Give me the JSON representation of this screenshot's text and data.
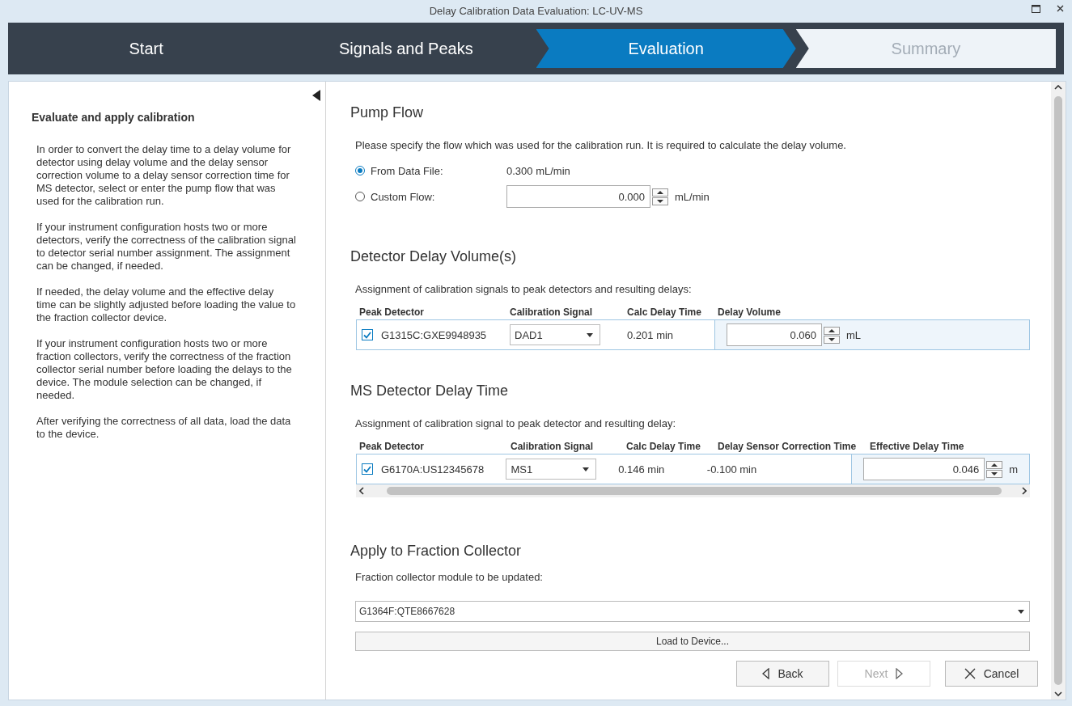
{
  "window": {
    "title": "Delay Calibration Data Evaluation: LC-UV-MS"
  },
  "steps": [
    {
      "label": "Start",
      "selected": false,
      "disabled": false
    },
    {
      "label": "Signals and Peaks",
      "selected": false,
      "disabled": false
    },
    {
      "label": "Evaluation",
      "selected": true,
      "disabled": false
    },
    {
      "label": "Summary",
      "selected": false,
      "disabled": true
    }
  ],
  "help": {
    "title": "Evaluate and apply calibration",
    "paragraphs": [
      "In order to convert the delay time to a delay volume for detector using delay volume and the delay sensor correction volume to a delay sensor correction time for MS detector, select or enter the pump flow that was used for the calibration run.",
      "If your instrument configuration hosts two or more detectors, verify the correctness of the calibration signal to detector serial number assignment. The assignment can be changed, if needed.",
      "If needed, the delay volume and the effective delay time can be slightly adjusted before loading the value to the fraction collector device.",
      "If your instrument configuration hosts two or more fraction collectors, verify the correctness of the fraction collector serial number before loading the delays to the device. The module selection can be changed, if needed.",
      "After verifying the correctness of all data, load the data to the device."
    ]
  },
  "pump_flow": {
    "title": "Pump Flow",
    "description": "Please specify the flow which was used for the calibration run. It is required to calculate the delay volume.",
    "options": [
      {
        "kind": "text",
        "label": "From Data File:",
        "selected": true,
        "value": "0.300 mL/min"
      },
      {
        "kind": "spin",
        "label": "Custom Flow:",
        "selected": false,
        "value": "0.000",
        "unit": "mL/min"
      }
    ]
  },
  "detector_delay": {
    "title": "Detector Delay Volume(s)",
    "description": "Assignment of calibration signals to peak detectors and resulting delays:",
    "columns": [
      "Peak Detector",
      "Calibration Signal",
      "Calc Delay Time",
      "Delay Volume"
    ],
    "rows": [
      {
        "checked": true,
        "cells": [
          "G1315C:GXE9948935",
          "DAD1",
          "0.201 min",
          "0.060"
        ],
        "unit": "mL"
      }
    ]
  },
  "ms_delay": {
    "title": "MS Detector Delay Time",
    "description": "Assignment of calibration signal to peak detector and resulting delay:",
    "columns": [
      "Peak Detector",
      "Calibration Signal",
      "Calc Delay Time",
      "Delay Sensor Correction Time",
      "Effective Delay Time"
    ],
    "rows": [
      {
        "checked": true,
        "cells": [
          "G6170A:US12345678",
          "MS1",
          "0.146 min",
          "-0.100 min",
          "0.046"
        ],
        "unit": "m"
      }
    ]
  },
  "fraction": {
    "title": "Apply to Fraction Collector",
    "label": "Fraction collector module to be updated:",
    "module": "G1364F:QTE8667628",
    "load_button": "Load to Device..."
  },
  "buttons": [
    {
      "kind": "back",
      "label": "Back",
      "disabled": false
    },
    {
      "kind": "next",
      "label": "Next",
      "disabled": true
    },
    {
      "kind": "cancel",
      "label": "Cancel",
      "disabled": false
    }
  ]
}
